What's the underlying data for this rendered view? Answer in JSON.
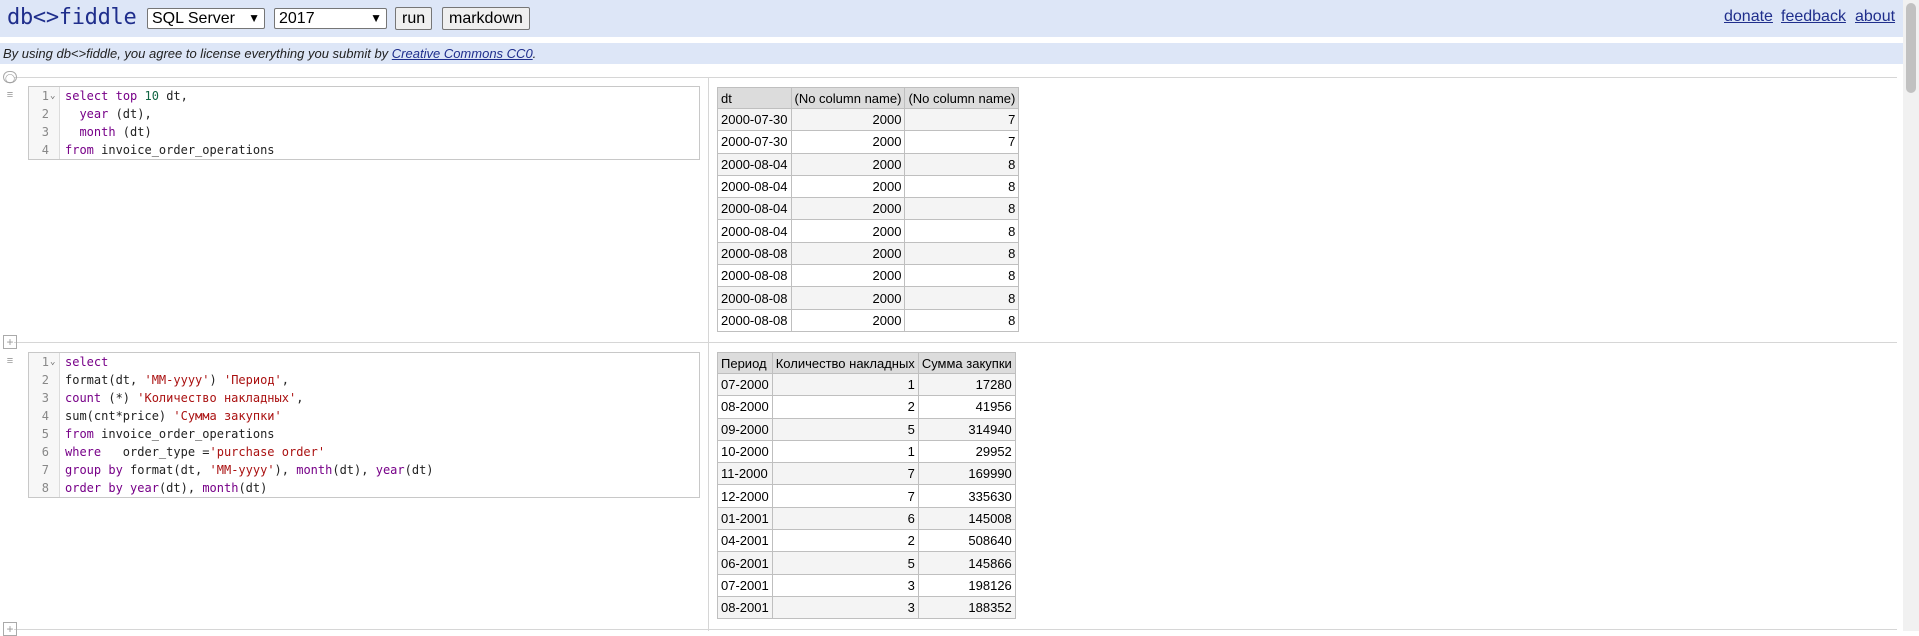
{
  "header": {
    "logo": "db<>fiddle",
    "db_select": "SQL Server",
    "version_select": "2017",
    "run_label": "run",
    "markdown_label": "markdown",
    "nav": {
      "donate": "donate",
      "feedback": "feedback",
      "about": "about"
    }
  },
  "notice": {
    "prefix": "By using db<>fiddle, you agree to license everything you submit by ",
    "link": "Creative Commons CC0",
    "suffix": "."
  },
  "query1": {
    "lines": [
      "select top 10 dt,",
      "  year (dt),",
      "  month (dt)",
      "from invoice_order_operations"
    ],
    "result": {
      "headers": [
        "dt",
        "(No column name)",
        "(No column name)"
      ],
      "rows": [
        [
          "2000-07-30",
          "2000",
          "7"
        ],
        [
          "2000-07-30",
          "2000",
          "7"
        ],
        [
          "2000-08-04",
          "2000",
          "8"
        ],
        [
          "2000-08-04",
          "2000",
          "8"
        ],
        [
          "2000-08-04",
          "2000",
          "8"
        ],
        [
          "2000-08-04",
          "2000",
          "8"
        ],
        [
          "2000-08-08",
          "2000",
          "8"
        ],
        [
          "2000-08-08",
          "2000",
          "8"
        ],
        [
          "2000-08-08",
          "2000",
          "8"
        ],
        [
          "2000-08-08",
          "2000",
          "8"
        ]
      ]
    }
  },
  "query2": {
    "lines": [
      "select",
      "format(dt, 'MM-yyyy') 'Период',",
      "count (*) 'Количество накладных',",
      "sum(cnt*price) 'Сумма закупки'",
      "from invoice_order_operations",
      "where   order_type ='purchase order'",
      "group by format(dt, 'MM-yyyy'), month(dt), year(dt)",
      "order by year(dt), month(dt)"
    ],
    "result": {
      "headers": [
        "Период",
        "Количество накладных",
        "Сумма закупки"
      ],
      "rows": [
        [
          "07-2000",
          "1",
          "17280"
        ],
        [
          "08-2000",
          "2",
          "41956"
        ],
        [
          "09-2000",
          "5",
          "314940"
        ],
        [
          "10-2000",
          "1",
          "29952"
        ],
        [
          "11-2000",
          "7",
          "169990"
        ],
        [
          "12-2000",
          "7",
          "335630"
        ],
        [
          "01-2001",
          "6",
          "145008"
        ],
        [
          "04-2001",
          "2",
          "508640"
        ],
        [
          "06-2001",
          "5",
          "145866"
        ],
        [
          "07-2001",
          "3",
          "198126"
        ],
        [
          "08-2001",
          "3",
          "188352"
        ]
      ]
    }
  }
}
